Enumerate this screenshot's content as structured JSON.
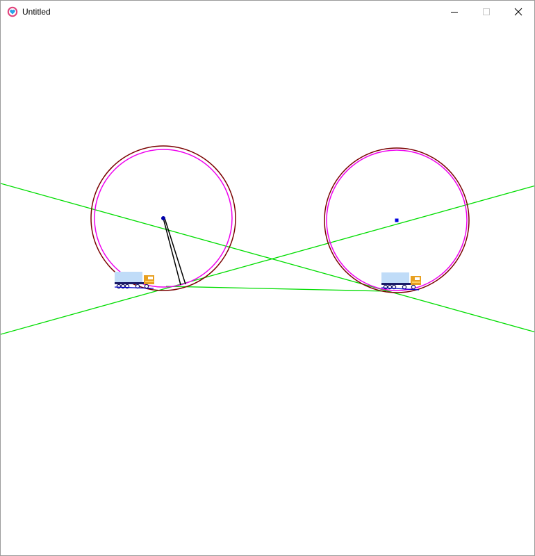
{
  "window": {
    "title": "Untitled",
    "app_icon": "heart-app-icon",
    "controls": {
      "minimize_icon": "minimize-icon",
      "maximize_icon": "maximize-icon",
      "close_icon": "close-icon"
    }
  },
  "scene": {
    "background": "#ffffff",
    "colors": {
      "outer_ring": "#7a0000",
      "inner_ring": "#ee00ee",
      "guide_line": "#00dd00",
      "center_dot": "#0000aa",
      "spoke": "#000000",
      "truck_cab": "#e8a020",
      "truck_box": "#c0dcf8"
    },
    "objects": [
      "wheel-left",
      "wheel-right",
      "truck-left",
      "truck-right",
      "green-lines",
      "pendulum"
    ]
  }
}
